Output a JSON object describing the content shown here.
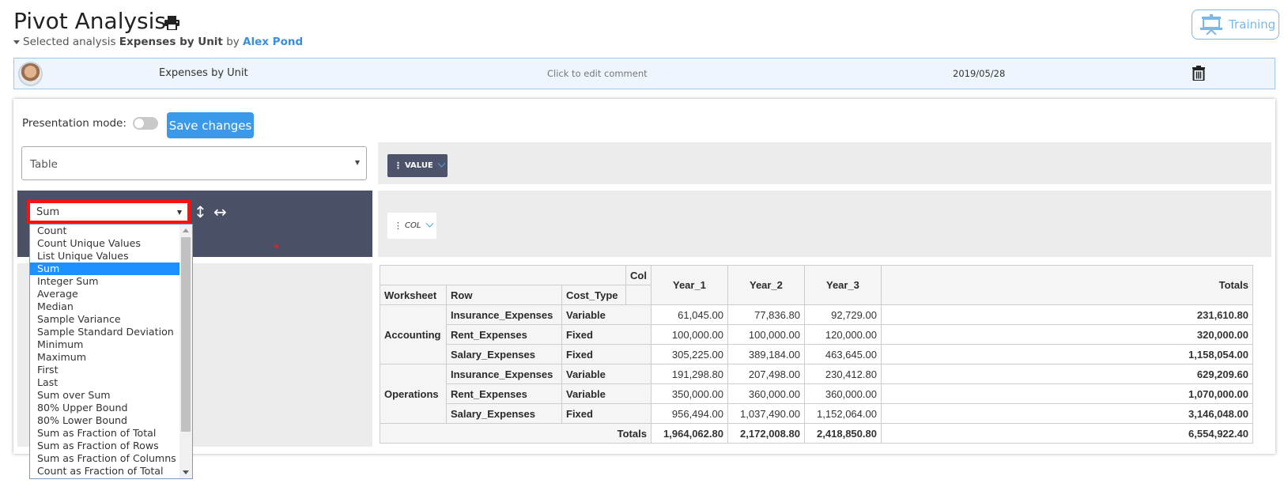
{
  "header": {
    "title": "Pivot Analysis",
    "selected_prefix": "Selected analysis",
    "analysis_name": "Expenses by Unit",
    "by": "by",
    "author": "Alex Pond",
    "training_label": "Training"
  },
  "analysis_row": {
    "name": "Expenses by Unit",
    "comment": "Click to edit comment",
    "date": "2019/05/28"
  },
  "controls": {
    "presentation_label": "Presentation mode:",
    "presentation_on": false,
    "save_label": "Save changes",
    "renderer": "Table",
    "value_chip": "VALUE",
    "col_chip": "COL",
    "aggregator": "Sum"
  },
  "aggregator_options": [
    "Count",
    "Count Unique Values",
    "List Unique Values",
    "Sum",
    "Integer Sum",
    "Average",
    "Median",
    "Sample Variance",
    "Sample Standard Deviation",
    "Minimum",
    "Maximum",
    "First",
    "Last",
    "Sum over Sum",
    "80% Upper Bound",
    "80% Lower Bound",
    "Sum as Fraction of Total",
    "Sum as Fraction of Rows",
    "Sum as Fraction of Columns",
    "Count as Fraction of Total"
  ],
  "aggregator_selected_index": 3,
  "table": {
    "col_attr": "Col",
    "row_attrs": [
      "Worksheet",
      "Row",
      "Cost_Type"
    ],
    "col_keys": [
      "Year_1",
      "Year_2",
      "Year_3"
    ],
    "totals_label": "Totals",
    "groups": [
      {
        "name": "Accounting",
        "rows": [
          {
            "row": "Insurance_Expenses",
            "type": "Variable",
            "values": [
              "61,045.00",
              "77,836.80",
              "92,729.00"
            ],
            "total": "231,610.80"
          },
          {
            "row": "Rent_Expenses",
            "type": "Fixed",
            "values": [
              "100,000.00",
              "100,000.00",
              "120,000.00"
            ],
            "total": "320,000.00"
          },
          {
            "row": "Salary_Expenses",
            "type": "Fixed",
            "values": [
              "305,225.00",
              "389,184.00",
              "463,645.00"
            ],
            "total": "1,158,054.00"
          }
        ]
      },
      {
        "name": "Operations",
        "rows": [
          {
            "row": "Insurance_Expenses",
            "type": "Variable",
            "values": [
              "191,298.80",
              "207,498.00",
              "230,412.80"
            ],
            "total": "629,209.60"
          },
          {
            "row": "Rent_Expenses",
            "type": "Variable",
            "values": [
              "350,000.00",
              "360,000.00",
              "360,000.00"
            ],
            "total": "1,070,000.00"
          },
          {
            "row": "Salary_Expenses",
            "type": "Fixed",
            "values": [
              "956,494.00",
              "1,037,490.00",
              "1,152,064.00"
            ],
            "total": "3,146,048.00"
          }
        ]
      }
    ],
    "col_totals": [
      "1,964,062.80",
      "2,172,008.80",
      "2,418,850.80"
    ],
    "grand_total": "6,554,922.40"
  }
}
